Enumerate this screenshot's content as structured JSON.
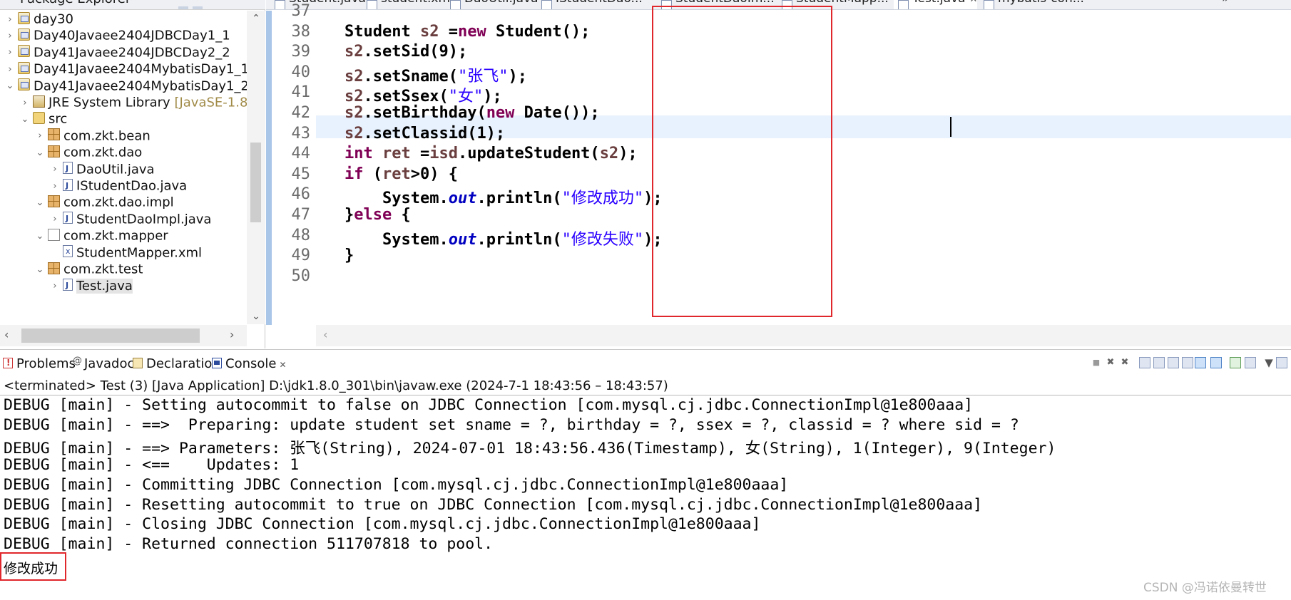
{
  "package_explorer": {
    "title": "Package Explorer",
    "close_glyph": "✕",
    "tree": [
      {
        "label": "day30",
        "icon": "project-icon",
        "indent": 0,
        "twisty": "›"
      },
      {
        "label": "Day40Javaee2404JDBCDay1_1",
        "icon": "project-icon",
        "indent": 0,
        "twisty": "›"
      },
      {
        "label": "Day41Javaee2404JDBCDay2_2",
        "icon": "project-icon",
        "indent": 0,
        "twisty": "›"
      },
      {
        "label": "Day41Javaee2404MybatisDay1_1",
        "icon": "project-icon",
        "indent": 0,
        "twisty": "›"
      },
      {
        "label": "Day41Javaee2404MybatisDay1_2",
        "icon": "project-icon",
        "indent": 0,
        "twisty": "⌄"
      },
      {
        "label": "JRE System Library",
        "decoration": "[JavaSE-1.8]",
        "icon": "library-icon",
        "indent": 1,
        "twisty": "›"
      },
      {
        "label": "src",
        "icon": "source-folder-icon",
        "indent": 1,
        "twisty": "⌄"
      },
      {
        "label": "com.zkt.bean",
        "icon": "package-icon",
        "indent": 2,
        "twisty": "›"
      },
      {
        "label": "com.zkt.dao",
        "icon": "package-icon",
        "indent": 2,
        "twisty": "⌄"
      },
      {
        "label": "DaoUtil.java",
        "icon": "java-file-icon",
        "indent": 3,
        "twisty": "›"
      },
      {
        "label": "IStudentDao.java",
        "icon": "java-file-icon",
        "indent": 3,
        "twisty": "›"
      },
      {
        "label": "com.zkt.dao.impl",
        "icon": "package-icon",
        "indent": 2,
        "twisty": "⌄"
      },
      {
        "label": "StudentDaoImpl.java",
        "icon": "java-file-icon",
        "indent": 3,
        "twisty": "›"
      },
      {
        "label": "com.zkt.mapper",
        "icon": "package-empty-icon",
        "indent": 2,
        "twisty": "⌄"
      },
      {
        "label": "StudentMapper.xml",
        "icon": "xml-file-icon",
        "indent": 3,
        "twisty": ""
      },
      {
        "label": "com.zkt.test",
        "icon": "package-icon",
        "indent": 2,
        "twisty": "⌄"
      },
      {
        "label": "Test.java",
        "icon": "java-file-icon",
        "indent": 3,
        "twisty": "›",
        "selected": true
      }
    ]
  },
  "editor": {
    "tabs": [
      {
        "label": "Student.java"
      },
      {
        "label": "student.xml"
      },
      {
        "label": "DaoUtil.java"
      },
      {
        "label": "IStudentDao..."
      },
      {
        "label": "StudentDaoIm..."
      },
      {
        "label": "StudentMapp..."
      },
      {
        "label": "Test.java",
        "active": true,
        "close": "✕"
      },
      {
        "label": "mybatis-con..."
      }
    ],
    "tabs_more": "»",
    "current_line_number": "42",
    "lines": [
      {
        "number": "37",
        "tokens": []
      },
      {
        "number": "38",
        "tokens": [
          [
            "",
            "Student "
          ],
          [
            "var",
            "s2"
          ],
          [
            "",
            " ="
          ],
          [
            "kw",
            "new"
          ],
          [
            "",
            " Student();"
          ]
        ]
      },
      {
        "number": "39",
        "tokens": [
          [
            "var",
            "s2"
          ],
          [
            "",
            ".setSid(9);"
          ]
        ]
      },
      {
        "number": "40",
        "tokens": [
          [
            "var",
            "s2"
          ],
          [
            "",
            ".setSname("
          ],
          [
            "str",
            "\"张飞\""
          ],
          [
            "",
            ");"
          ]
        ]
      },
      {
        "number": "41",
        "tokens": [
          [
            "var",
            "s2"
          ],
          [
            "",
            ".setSsex("
          ],
          [
            "str",
            "\"女\""
          ],
          [
            "",
            ");"
          ]
        ]
      },
      {
        "number": "42",
        "tokens": [
          [
            "var",
            "s2"
          ],
          [
            "",
            ".setBirthday("
          ],
          [
            "kw",
            "new"
          ],
          [
            "",
            " Date());"
          ]
        ]
      },
      {
        "number": "43",
        "tokens": [
          [
            "var",
            "s2"
          ],
          [
            "",
            ".setClassid(1);"
          ]
        ]
      },
      {
        "number": "44",
        "tokens": [
          [
            "kw",
            "int"
          ],
          [
            "",
            " "
          ],
          [
            "var",
            "ret"
          ],
          [
            "",
            " ="
          ],
          [
            "var",
            "isd"
          ],
          [
            "",
            ".updateStudent("
          ],
          [
            "var",
            "s2"
          ],
          [
            "",
            ");"
          ]
        ]
      },
      {
        "number": "45",
        "tokens": [
          [
            "kw",
            "if"
          ],
          [
            "",
            " ("
          ],
          [
            "var",
            "ret"
          ],
          [
            "",
            ">0) {"
          ]
        ]
      },
      {
        "number": "46",
        "tokens": [
          [
            "",
            "    System."
          ],
          [
            "fld",
            "out"
          ],
          [
            "",
            ".println("
          ],
          [
            "str",
            "\"修改成功\""
          ],
          [
            "",
            ");"
          ]
        ]
      },
      {
        "number": "47",
        "tokens": [
          [
            "",
            "}"
          ],
          [
            "kw",
            "else"
          ],
          [
            "",
            " {"
          ]
        ]
      },
      {
        "number": "48",
        "tokens": [
          [
            "",
            "    System."
          ],
          [
            "fld",
            "out"
          ],
          [
            "",
            ".println("
          ],
          [
            "str",
            "\"修改失败\""
          ],
          [
            "",
            ");"
          ]
        ]
      },
      {
        "number": "49",
        "tokens": [
          [
            "",
            "}"
          ]
        ]
      },
      {
        "number": "50",
        "tokens": []
      }
    ]
  },
  "console": {
    "tabs": [
      {
        "label": "Problems",
        "icon": "problems-icon"
      },
      {
        "label": "Javadoc",
        "icon": "javadoc-icon"
      },
      {
        "label": "Declaration",
        "icon": "declaration-icon"
      },
      {
        "label": "Console",
        "icon": "console-icon",
        "active": true,
        "close": "✕"
      }
    ],
    "toolbar": [
      "stop-icon",
      "remove-launch-icon",
      "remove-all-terminated-icon",
      "scroll-lock-icon",
      "word-wrap-icon",
      "show-on-output-icon",
      "show-on-error-icon",
      "pin-console-icon",
      "display-selected-console-icon",
      "open-console-icon",
      "view-menu-icon",
      "minimize-icon",
      "maximize-icon"
    ],
    "status": "<terminated> Test (3) [Java Application] D:\\jdk1.8.0_301\\bin\\javaw.exe  (2024-7-1 18:43:56 – 18:43:57)",
    "output": [
      "DEBUG [main] - Setting autocommit to false on JDBC Connection [com.mysql.cj.jdbc.ConnectionImpl@1e800aaa]",
      "DEBUG [main] - ==>  Preparing: update student set sname = ?, birthday = ?, ssex = ?, classid = ? where sid = ?",
      "DEBUG [main] - ==> Parameters: 张飞(String), 2024-07-01 18:43:56.436(Timestamp), 女(String), 1(Integer), 9(Integer)",
      "DEBUG [main] - <==    Updates: 1",
      "DEBUG [main] - Committing JDBC Connection [com.mysql.cj.jdbc.ConnectionImpl@1e800aaa]",
      "DEBUG [main] - Resetting autocommit to true on JDBC Connection [com.mysql.cj.jdbc.ConnectionImpl@1e800aaa]",
      "DEBUG [main] - Closing JDBC Connection [com.mysql.cj.jdbc.ConnectionImpl@1e800aaa]",
      "DEBUG [main] - Returned connection 511707818 to pool."
    ],
    "result": "修改成功"
  },
  "colors": {
    "annotation_box": "#e0272b",
    "keyword": "#7f0055",
    "string": "#2a00ff",
    "field": "#0000c0",
    "local_variable": "#6a3e3e",
    "current_line": "#e8f2fe"
  },
  "watermark": "CSDN @冯诺依曼转世"
}
